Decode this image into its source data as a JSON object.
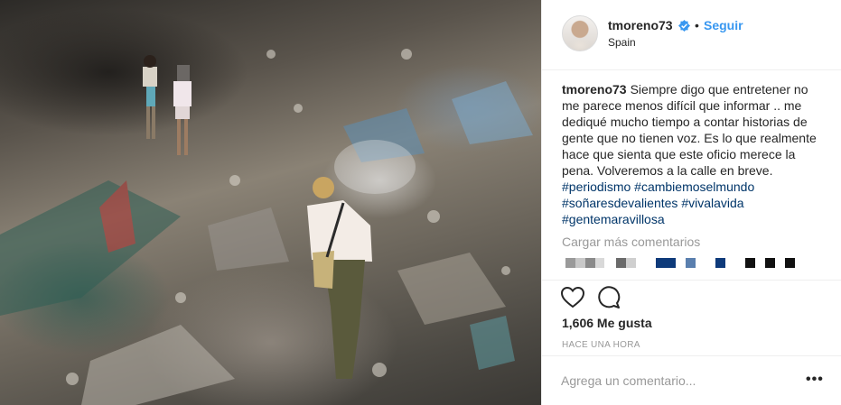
{
  "post": {
    "image_alt": "Photo of people walking on a large garbage dump",
    "colors": {
      "accent": "#3897f0",
      "hashtag": "#003569",
      "muted": "#999999",
      "text": "#262626"
    }
  },
  "header": {
    "username": "tmoreno73",
    "verified_icon": "verified-badge-icon",
    "separator": "•",
    "follow_label": "Seguir",
    "location": "Spain"
  },
  "caption": {
    "username": "tmoreno73",
    "text": "Siempre digo que entretener no me parece menos difícil que informar .. me dediqué mucho tiempo a contar historias de gente que no tienen voz. Es lo que realmente hace que sienta que este oficio merece la pena. Volveremos a la calle en breve. ",
    "hashtags": [
      "#periodismo",
      "#cambiemoselmundo",
      "#soñaresdevalientes",
      "#vivalavida",
      "#gentemaravillosa"
    ]
  },
  "comments": {
    "load_more_label": "Cargar más comentarios"
  },
  "actions": {
    "like_icon": "heart-icon",
    "comment_icon": "comment-icon",
    "likes_label": "1,606 Me gusta",
    "timestamp": "HACE UNA HORA"
  },
  "add_comment": {
    "placeholder": "Agrega un comentario...",
    "more_icon": "more-options-icon",
    "more_label": "•••"
  }
}
